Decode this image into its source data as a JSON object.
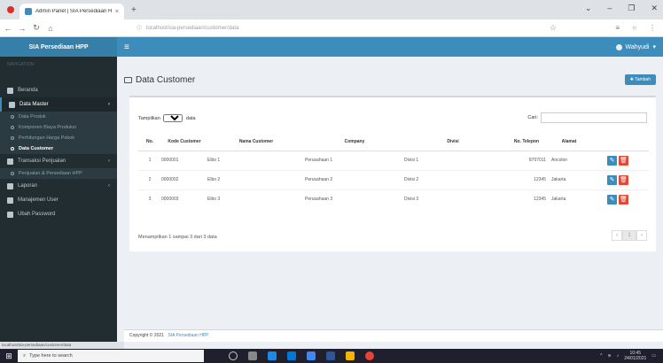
{
  "browser": {
    "tab_title": "Admin Panel | SIA Persediaan H",
    "tab_close": "×",
    "new_tab": "+",
    "url": "localhost/sia-persediaan/customer/data",
    "window_controls": [
      "⌄",
      "–",
      "❐",
      "✕"
    ]
  },
  "app": {
    "brand": "SIA Persediaan HPP",
    "user_name": "Wahyudi"
  },
  "sidebar": {
    "header_label": "NAVIGATION",
    "items": [
      {
        "label": "Beranda",
        "icon": "home-icon",
        "type": "main"
      },
      {
        "label": "Data Master",
        "icon": "database-icon",
        "type": "main",
        "chevron": "‹"
      },
      {
        "label": "Data Produk",
        "type": "sub"
      },
      {
        "label": "Komponen Biaya Produksi",
        "type": "sub"
      },
      {
        "label": "Perhitungan Harga Pokok",
        "type": "sub"
      },
      {
        "label": "Data Customer",
        "type": "sub",
        "active": true
      },
      {
        "label": "Transaksi Penjualan",
        "icon": "cart-icon",
        "type": "main",
        "chevron": "‹"
      },
      {
        "label": "Penjualan & Persediaan HPP",
        "type": "sub"
      },
      {
        "label": "Laporan",
        "icon": "report-icon",
        "type": "main",
        "chevron": "‹"
      },
      {
        "label": "Manajemen User",
        "icon": "user-icon",
        "type": "main"
      },
      {
        "label": "Ubah Password",
        "icon": "lock-icon",
        "type": "main"
      }
    ]
  },
  "page": {
    "title": "Data Customer",
    "add_button": "Tambah"
  },
  "table_controls": {
    "show_label": "Tampilkan",
    "length_value": "10",
    "entries_label": "data",
    "search_label": "Cari:"
  },
  "table": {
    "columns": [
      "No.",
      "Kode Customer",
      "Nama Customer",
      "Company",
      "Divisi",
      "No. Telepon",
      "Alamat",
      ""
    ],
    "rows": [
      [
        "1",
        "0000001",
        "Elbo 1",
        "Perusahaan 1",
        "Divisi 1",
        "8707011",
        "Ancolon"
      ],
      [
        "2",
        "0000002",
        "Elbo 2",
        "Perusahaan 2",
        "Divisi 2",
        "12345",
        "Jakarta"
      ],
      [
        "3",
        "0000003",
        "Elbo 3",
        "Perusahaan 3",
        "Divisi 3",
        "12345",
        "Jakarta"
      ]
    ],
    "info": "Menampilkan 1 sampai 3 dari 3 data",
    "pager": [
      "‹",
      "1",
      "›"
    ]
  },
  "footer": {
    "copyright": "Copyright © 2021",
    "link": "SIA Persediaan HPP"
  },
  "status_bar_url": "localhost/sia-persediaan/customer/data",
  "taskbar": {
    "search_placeholder": "Type here to search",
    "time": "10:45",
    "date": "24/01/2021"
  },
  "colors": {
    "primary": "#3c8dbc",
    "danger": "#dd4b39",
    "sidebar": "#222d32"
  }
}
